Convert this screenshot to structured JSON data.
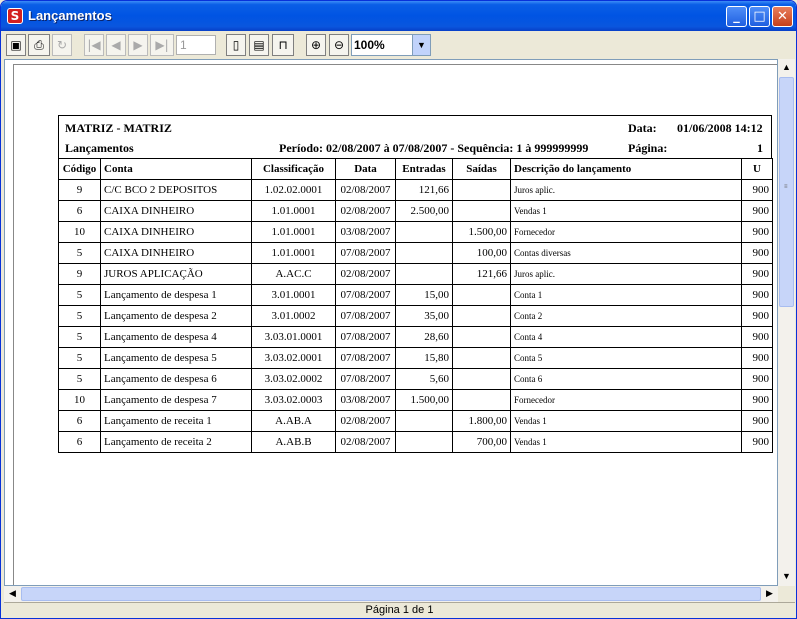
{
  "window": {
    "title": "Lançamentos"
  },
  "toolbar": {
    "page_number": "1",
    "zoom": "100%"
  },
  "report": {
    "company": "MATRIZ - MATRIZ",
    "date_label": "Data:",
    "date_value": "01/06/2008 14:12",
    "report_name": "Lançamentos",
    "period": "Período: 02/08/2007 à 07/08/2007  -  Sequência: 1 à 999999999",
    "page_label": "Página:",
    "page_value": "1",
    "columns": [
      "Código",
      "Conta",
      "Classificação",
      "Data",
      "Entradas",
      "Saídas",
      "Descrição do lançamento",
      "U"
    ],
    "rows": [
      [
        "9",
        "C/C BCO 2 DEPOSITOS",
        "1.02.02.0001",
        "02/08/2007",
        "121,66",
        "",
        "Juros aplic.",
        "900"
      ],
      [
        "6",
        "CAIXA DINHEIRO",
        "1.01.0001",
        "02/08/2007",
        "2.500,00",
        "",
        "Vendas 1",
        "900"
      ],
      [
        "10",
        "CAIXA DINHEIRO",
        "1.01.0001",
        "03/08/2007",
        "",
        "1.500,00",
        "Fornecedor",
        "900"
      ],
      [
        "5",
        "CAIXA DINHEIRO",
        "1.01.0001",
        "07/08/2007",
        "",
        "100,00",
        "Contas diversas",
        "900"
      ],
      [
        "9",
        "JUROS APLICAÇÃO",
        "A.AC.C",
        "02/08/2007",
        "",
        "121,66",
        "Juros aplic.",
        "900"
      ],
      [
        "5",
        "Lançamento de despesa 1",
        "3.01.0001",
        "07/08/2007",
        "15,00",
        "",
        "Conta 1",
        "900"
      ],
      [
        "5",
        "Lançamento de despesa 2",
        "3.01.0002",
        "07/08/2007",
        "35,00",
        "",
        "Conta 2",
        "900"
      ],
      [
        "5",
        "Lançamento de despesa 4",
        "3.03.01.0001",
        "07/08/2007",
        "28,60",
        "",
        "Conta 4",
        "900"
      ],
      [
        "5",
        "Lançamento de despesa 5",
        "3.03.02.0001",
        "07/08/2007",
        "15,80",
        "",
        "Conta 5",
        "900"
      ],
      [
        "5",
        "Lançamento de despesa 6",
        "3.03.02.0002",
        "07/08/2007",
        "5,60",
        "",
        "Conta 6",
        "900"
      ],
      [
        "10",
        "Lançamento de despesa 7",
        "3.03.02.0003",
        "03/08/2007",
        "1.500,00",
        "",
        "Fornecedor",
        "900"
      ],
      [
        "6",
        "Lançamento de receita 1",
        "A.AB.A",
        "02/08/2007",
        "",
        "1.800,00",
        "Vendas 1",
        "900"
      ],
      [
        "6",
        "Lançamento de receita 2",
        "A.AB.B",
        "02/08/2007",
        "",
        "700,00",
        "Vendas 1",
        "900"
      ]
    ]
  },
  "status": {
    "text": "Página 1 de 1"
  },
  "icons": {
    "save": "floppy-disk-icon",
    "print": "printer-icon",
    "refresh": "refresh-icon",
    "first": "first-page-icon",
    "prev": "previous-page-icon",
    "next": "next-page-icon",
    "last": "last-page-icon",
    "page_full": "full-page-icon",
    "page_width": "page-width-icon",
    "page_fit": "page-fit-icon",
    "zoom_in": "zoom-in-icon",
    "zoom_out": "zoom-out-icon"
  }
}
